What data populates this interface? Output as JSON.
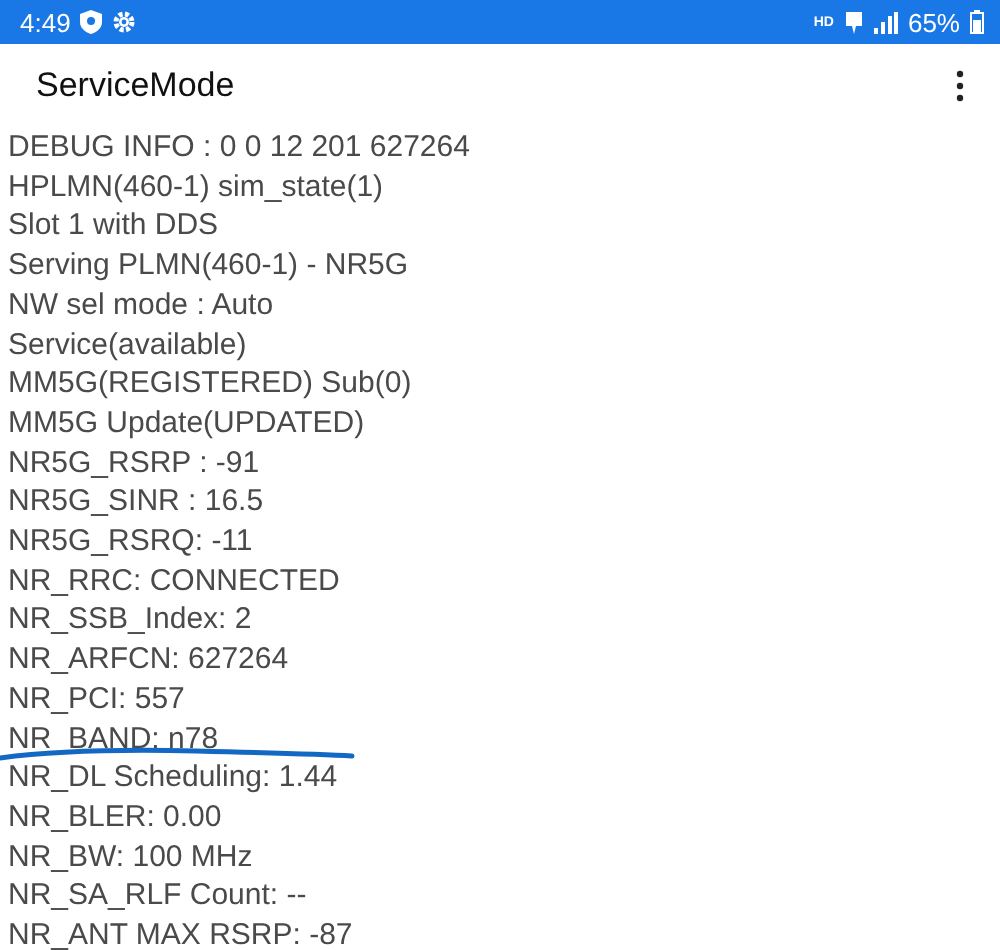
{
  "status_bar": {
    "time": "4:49",
    "network_badge": "HD",
    "battery": "65%"
  },
  "app_bar": {
    "title": "ServiceMode"
  },
  "lines": [
    {
      "text": "DEBUG INFO : 0 0 12 201 627264",
      "underlined": false
    },
    {
      "text": "HPLMN(460-1) sim_state(1)",
      "underlined": false
    },
    {
      "text": "Slot 1 with DDS",
      "underlined": false
    },
    {
      "text": "Serving PLMN(460-1) - NR5G",
      "underlined": false
    },
    {
      "text": "NW sel mode : Auto",
      "underlined": false
    },
    {
      "text": "Service(available)",
      "underlined": false
    },
    {
      "text": "MM5G(REGISTERED) Sub(0)",
      "underlined": false
    },
    {
      "text": "MM5G Update(UPDATED)",
      "underlined": false
    },
    {
      "text": "NR5G_RSRP : -91",
      "underlined": false
    },
    {
      "text": "NR5G_SINR : 16.5",
      "underlined": false
    },
    {
      "text": "NR5G_RSRQ: -11",
      "underlined": false
    },
    {
      "text": "NR_RRC: CONNECTED",
      "underlined": false
    },
    {
      "text": "NR_SSB_Index: 2",
      "underlined": false
    },
    {
      "text": "NR_ARFCN: 627264",
      "underlined": false
    },
    {
      "text": "NR_PCI: 557",
      "underlined": false
    },
    {
      "text": "NR_BAND: n78",
      "underlined": true
    },
    {
      "text": "NR_DL Scheduling: 1.44",
      "underlined": false
    },
    {
      "text": "NR_BLER: 0.00",
      "underlined": false
    },
    {
      "text": "NR_BW: 100 MHz",
      "underlined": false
    },
    {
      "text": "NR_SA_RLF Count: --",
      "underlined": false
    },
    {
      "text": "NR_ANT MAX RSRP: -87",
      "underlined": false
    }
  ]
}
